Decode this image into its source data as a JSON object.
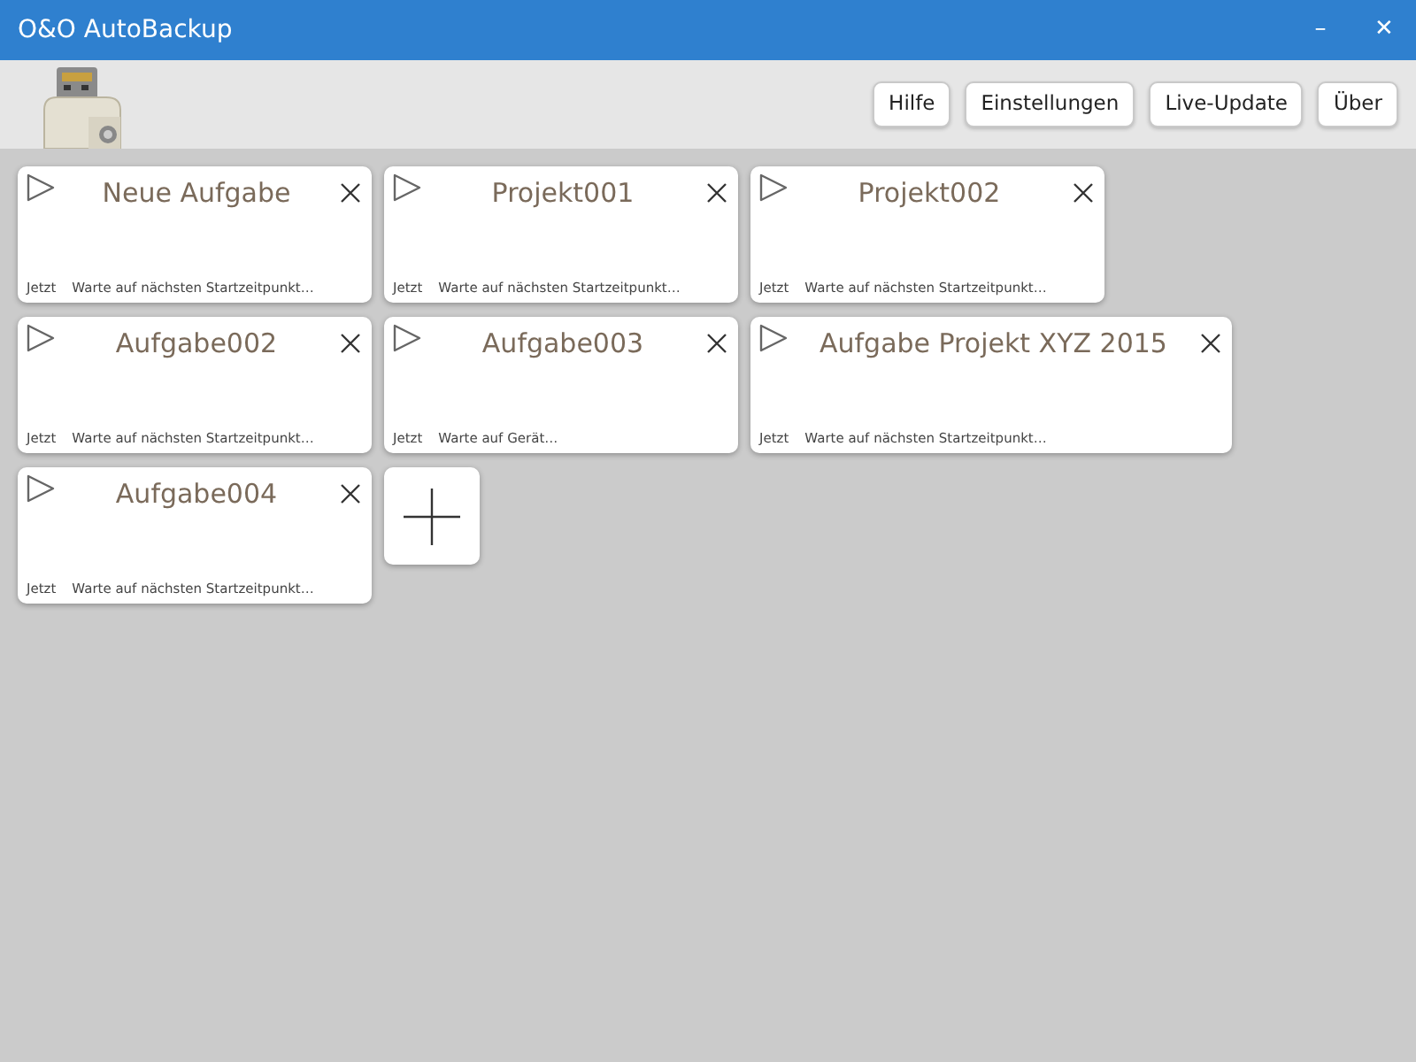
{
  "window": {
    "title": "O&O AutoBackup",
    "controls": [
      "–",
      "✕"
    ]
  },
  "toolbar": {
    "buttons": [
      "Hilfe",
      "Einstellungen",
      "Live-Update",
      "Über"
    ]
  },
  "task_rows": [
    [
      {
        "title": "Neue Aufgabe",
        "time": "Jetzt",
        "status": "Warte auf nächsten Startzeitpunkt…"
      },
      {
        "title": "Projekt001",
        "time": "Jetzt",
        "status": "Warte auf nächsten Startzeitpunkt…"
      },
      {
        "title": "Projekt002",
        "time": "Jetzt",
        "status": "Warte auf nächsten Startzeitpunkt…"
      }
    ],
    [
      {
        "title": "Aufgabe002",
        "time": "Jetzt",
        "status": "Warte auf nächsten Startzeitpunkt…"
      },
      {
        "title": "Aufgabe003",
        "time": "Jetzt",
        "status": "Warte auf Gerät…"
      },
      {
        "title": "Aufgabe Projekt XYZ 2015",
        "time": "Jetzt",
        "status": "Warte auf nächsten Startzeitpunkt…"
      }
    ],
    [
      {
        "title": "Aufgabe004",
        "time": "Jetzt",
        "status": "Warte auf nächsten Startzeitpunkt…"
      }
    ]
  ],
  "add_task": true
}
